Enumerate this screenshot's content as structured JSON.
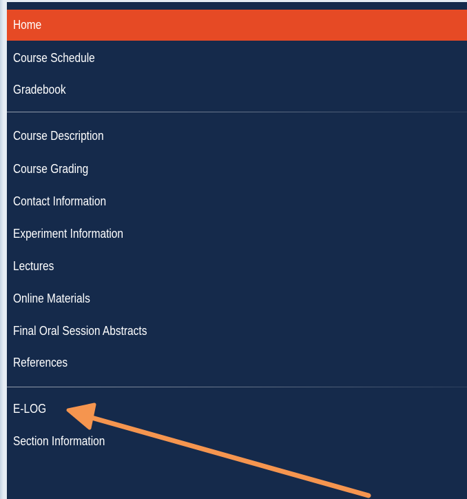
{
  "nav": {
    "items": [
      {
        "label": "Home",
        "active": true
      },
      {
        "label": "Course Schedule"
      },
      {
        "label": "Gradebook"
      },
      {
        "label": "Course Description"
      },
      {
        "label": "Course Grading"
      },
      {
        "label": "Contact Information"
      },
      {
        "label": "Experiment Information"
      },
      {
        "label": "Lectures"
      },
      {
        "label": "Online Materials"
      },
      {
        "label": "Final Oral Session Abstracts"
      },
      {
        "label": "References"
      },
      {
        "label": "E-LOG"
      },
      {
        "label": "Section Information"
      }
    ]
  },
  "colors": {
    "nav_background": "#152a4b",
    "active_background": "#e64a25",
    "arrow": "#f5954f"
  }
}
